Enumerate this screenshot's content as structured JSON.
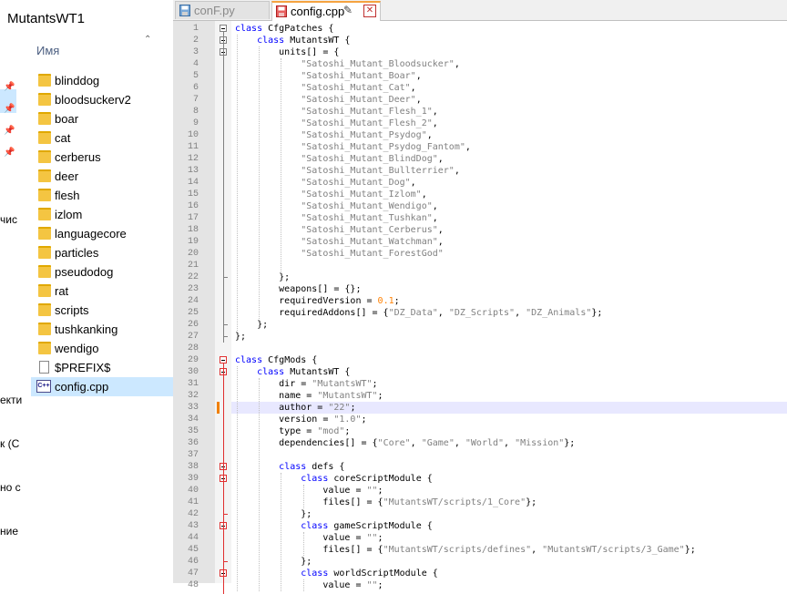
{
  "explorer": {
    "title": "MutantsWT1",
    "column_header": "Имя",
    "nav_partial": [
      "чис",
      "екти",
      "к (C",
      "но с",
      "ние"
    ],
    "files": [
      {
        "name": "blinddog",
        "type": "folder"
      },
      {
        "name": "bloodsuckerv2",
        "type": "folder"
      },
      {
        "name": "boar",
        "type": "folder"
      },
      {
        "name": "cat",
        "type": "folder"
      },
      {
        "name": "cerberus",
        "type": "folder"
      },
      {
        "name": "deer",
        "type": "folder"
      },
      {
        "name": "flesh",
        "type": "folder"
      },
      {
        "name": "izlom",
        "type": "folder"
      },
      {
        "name": "languagecore",
        "type": "folder"
      },
      {
        "name": "particles",
        "type": "folder"
      },
      {
        "name": "pseudodog",
        "type": "folder"
      },
      {
        "name": "rat",
        "type": "folder"
      },
      {
        "name": "scripts",
        "type": "folder"
      },
      {
        "name": "tushkanking",
        "type": "folder"
      },
      {
        "name": "wendigo",
        "type": "folder"
      },
      {
        "name": "$PREFIX$",
        "type": "file"
      },
      {
        "name": "config.cpp",
        "type": "cpp",
        "selected": true
      }
    ]
  },
  "editor": {
    "tabs": [
      {
        "label": "conF.py",
        "active": false
      },
      {
        "label": "config.cpp",
        "active": true
      }
    ],
    "current_line": 33,
    "lines": [
      {
        "n": 1,
        "code": "class CfgPatches {"
      },
      {
        "n": 2,
        "code": "    class MutantsWT {"
      },
      {
        "n": 3,
        "code": "        units[] = {"
      },
      {
        "n": 4,
        "code": "            \"Satoshi_Mutant_Bloodsucker\","
      },
      {
        "n": 5,
        "code": "            \"Satoshi_Mutant_Boar\","
      },
      {
        "n": 6,
        "code": "            \"Satoshi_Mutant_Cat\","
      },
      {
        "n": 7,
        "code": "            \"Satoshi_Mutant_Deer\","
      },
      {
        "n": 8,
        "code": "            \"Satoshi_Mutant_Flesh_1\","
      },
      {
        "n": 9,
        "code": "            \"Satoshi_Mutant_Flesh_2\","
      },
      {
        "n": 10,
        "code": "            \"Satoshi_Mutant_Psydog\","
      },
      {
        "n": 11,
        "code": "            \"Satoshi_Mutant_Psydog_Fantom\","
      },
      {
        "n": 12,
        "code": "            \"Satoshi_Mutant_BlindDog\","
      },
      {
        "n": 13,
        "code": "            \"Satoshi_Mutant_Bullterrier\","
      },
      {
        "n": 14,
        "code": "            \"Satoshi_Mutant_Dog\","
      },
      {
        "n": 15,
        "code": "            \"Satoshi_Mutant_Izlom\","
      },
      {
        "n": 16,
        "code": "            \"Satoshi_Mutant_Wendigo\","
      },
      {
        "n": 17,
        "code": "            \"Satoshi_Mutant_Tushkan\","
      },
      {
        "n": 18,
        "code": "            \"Satoshi_Mutant_Cerberus\","
      },
      {
        "n": 19,
        "code": "            \"Satoshi_Mutant_Watchman\","
      },
      {
        "n": 20,
        "code": "            \"Satoshi_Mutant_ForestGod\""
      },
      {
        "n": 21,
        "code": ""
      },
      {
        "n": 22,
        "code": "        };"
      },
      {
        "n": 23,
        "code": "        weapons[] = {};"
      },
      {
        "n": 24,
        "code": "        requiredVersion = 0.1;"
      },
      {
        "n": 25,
        "code": "        requiredAddons[] = {\"DZ_Data\", \"DZ_Scripts\", \"DZ_Animals\"};"
      },
      {
        "n": 26,
        "code": "    };"
      },
      {
        "n": 27,
        "code": "};"
      },
      {
        "n": 28,
        "code": ""
      },
      {
        "n": 29,
        "code": "class CfgMods {"
      },
      {
        "n": 30,
        "code": "    class MutantsWT {"
      },
      {
        "n": 31,
        "code": "        dir = \"MutantsWT\";"
      },
      {
        "n": 32,
        "code": "        name = \"MutantsWT\";"
      },
      {
        "n": 33,
        "code": "        author = \"22\";"
      },
      {
        "n": 34,
        "code": "        version = \"1.0\";"
      },
      {
        "n": 35,
        "code": "        type = \"mod\";"
      },
      {
        "n": 36,
        "code": "        dependencies[] = {\"Core\", \"Game\", \"World\", \"Mission\"};"
      },
      {
        "n": 37,
        "code": ""
      },
      {
        "n": 38,
        "code": "        class defs {"
      },
      {
        "n": 39,
        "code": "            class coreScriptModule {"
      },
      {
        "n": 40,
        "code": "                value = \"\";"
      },
      {
        "n": 41,
        "code": "                files[] = {\"MutantsWT/scripts/1_Core\"};"
      },
      {
        "n": 42,
        "code": "            };"
      },
      {
        "n": 43,
        "code": "            class gameScriptModule {"
      },
      {
        "n": 44,
        "code": "                value = \"\";"
      },
      {
        "n": 45,
        "code": "                files[] = {\"MutantsWT/scripts/defines\", \"MutantsWT/scripts/3_Game\"};"
      },
      {
        "n": 46,
        "code": "            };"
      },
      {
        "n": 47,
        "code": "            class worldScriptModule {"
      },
      {
        "n": 48,
        "code": "                value = \"\";"
      }
    ]
  }
}
